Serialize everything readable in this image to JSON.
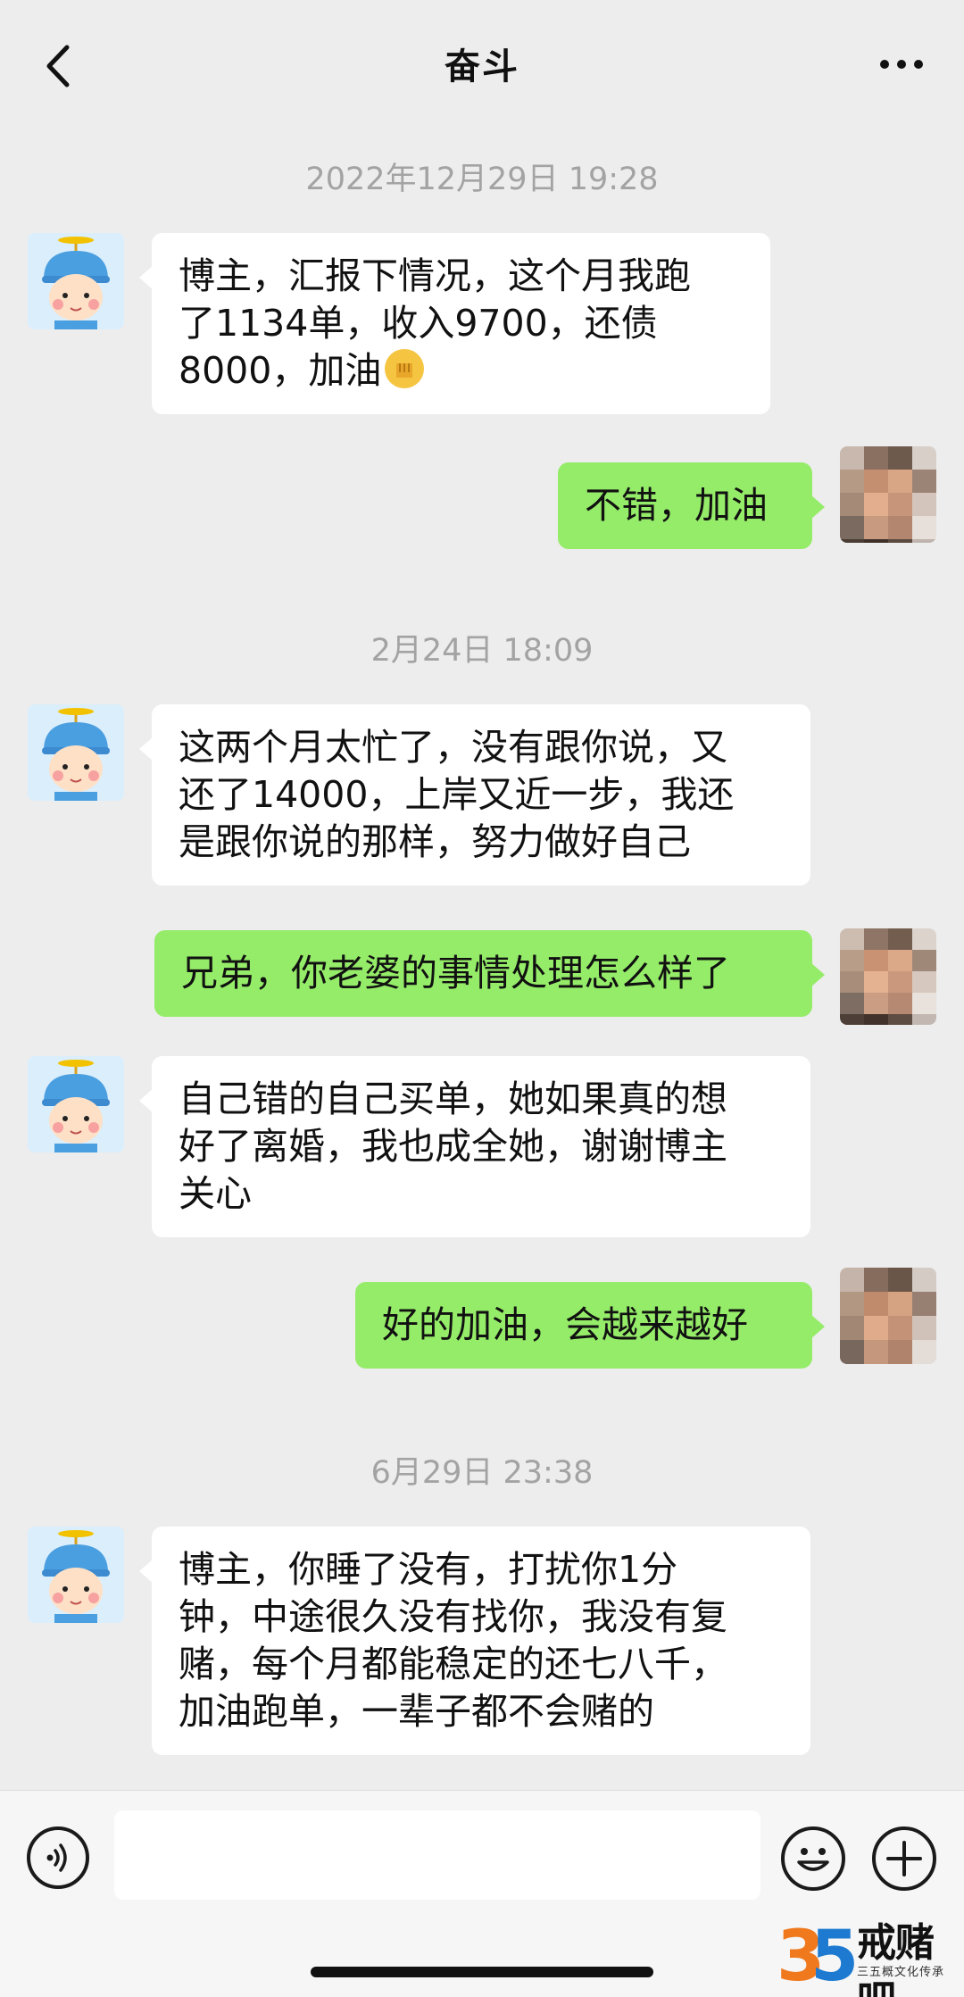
{
  "header": {
    "title": "奋斗",
    "back_icon": "chevron-left-icon",
    "more_icon": "more-dots-icon"
  },
  "messages": [
    {
      "type": "timestamp",
      "text": "2022年12月29日 19:28"
    },
    {
      "type": "received",
      "lines": [
        "博主，汇报下情况，这个月我跑",
        "了1134单，收入9700，还债",
        "8000，加油"
      ],
      "emoji": "fist-emoji"
    },
    {
      "type": "sent",
      "lines": [
        "不错，加油"
      ]
    },
    {
      "type": "timestamp",
      "text": "2月24日 18:09"
    },
    {
      "type": "received",
      "lines": [
        "这两个月太忙了，没有跟你说，又",
        "还了14000，上岸又近一步，我还",
        "是跟你说的那样，努力做好自己"
      ]
    },
    {
      "type": "sent",
      "lines": [
        "兄弟，你老婆的事情处理怎么样了"
      ]
    },
    {
      "type": "received",
      "lines": [
        "自己错的自己买单，她如果真的想",
        "好了离婚，我也成全她，谢谢博主",
        "关心"
      ]
    },
    {
      "type": "sent",
      "lines": [
        "好的加油，会越来越好"
      ]
    },
    {
      "type": "timestamp",
      "text": "6月29日 23:38"
    },
    {
      "type": "received",
      "lines": [
        "博主，你睡了没有，打扰你1分",
        "钟，中途很久没有找你，我没有复",
        "赌，每个月都能稳定的还七八千，",
        "加油跑单，一辈子都不会赌的"
      ]
    }
  ],
  "input_bar": {
    "voice_icon": "voice-icon",
    "emoji_icon": "emoji-icon",
    "plus_icon": "plus-icon",
    "input_value": ""
  },
  "watermark": {
    "logo_text": "35",
    "name": "戒赌吧",
    "subtitle": "三五概文化传承"
  },
  "colors": {
    "background": "#ededed",
    "sent_bubble": "#95ec69",
    "received_bubble": "#ffffff",
    "timestamp": "#a3a3a3",
    "logo_orange": "#f0791e",
    "logo_blue": "#1e7ad0"
  }
}
